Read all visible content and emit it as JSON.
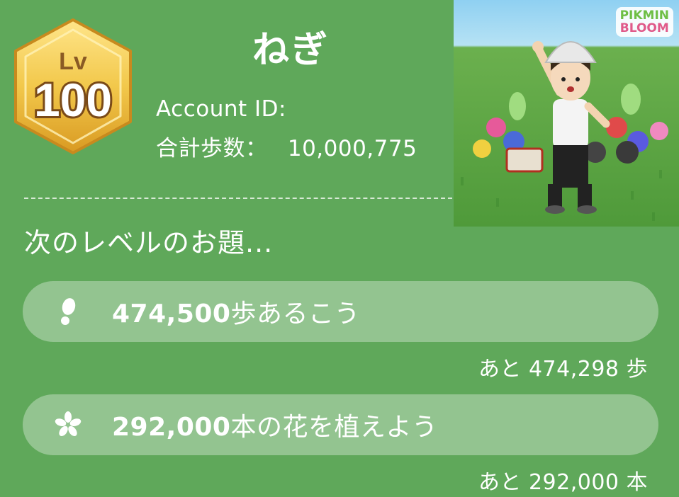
{
  "profile": {
    "level_label": "Lv",
    "level": "100",
    "name": "ねぎ",
    "account_id_label": "Account ID:",
    "total_steps_label": "合計歩数：",
    "total_steps": "10,000,775"
  },
  "photo": {
    "logo_line1": "PIKMIN",
    "logo_line2": "BLOOM"
  },
  "next_level": {
    "title": "次のレベルのお題...",
    "tasks": [
      {
        "icon": "footprint-icon",
        "amount": "474,500",
        "text": "歩あるこう",
        "remaining_prefix": "あと",
        "remaining_value": "474,298",
        "remaining_unit": "歩"
      },
      {
        "icon": "flower-icon",
        "amount": "292,000",
        "text": "本の花を植えよう",
        "remaining_prefix": "あと",
        "remaining_value": "292,000",
        "remaining_unit": "本"
      }
    ]
  },
  "colors": {
    "background": "#5fa85a",
    "badge_gold": "#f2c84b",
    "badge_brown": "#8a5a24",
    "text": "#ffffff"
  }
}
